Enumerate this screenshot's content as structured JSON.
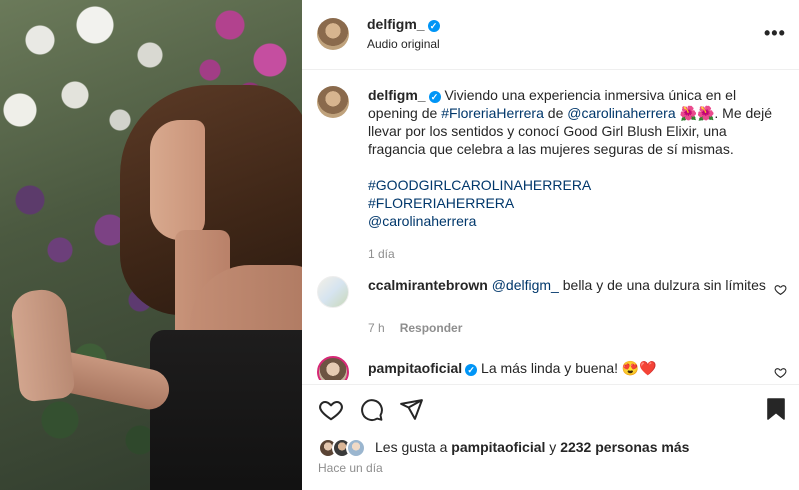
{
  "header": {
    "username": "delfigm_",
    "subtitle": "Audio original",
    "more_label": "•••"
  },
  "caption": {
    "username": "delfigm_",
    "text_1": "Viviendo una experiencia inmersiva única en el opening de ",
    "hashtag_floreria_inline": "#FloreriaHerrera",
    "text_2": " de ",
    "mention_inline": "@carolinaherrera",
    "emoji": "🌺🌺",
    "text_3": ". Me dejé llevar por los sentidos y conocí Good Girl Blush Elixir, una fragancia que celebra a las mujeres seguras de sí mismas.",
    "hashtag_1": "#GOODGIRLCAROLINAHERRERA",
    "hashtag_2": "#FLORERIAHERRERA",
    "mention_2": "@carolinaherrera",
    "time": "1 día"
  },
  "comments": [
    {
      "username": "ccalmirantebrown",
      "mention": "@delfigm_",
      "text": " bella y de una dulzura sin límites",
      "time": "7 h",
      "reply_label": "Responder"
    },
    {
      "username": "pampitaoficial",
      "text": "La más linda y buena! 😍❤️"
    }
  ],
  "likes": {
    "prefix": "Les gusta a ",
    "user": "pampitaoficial",
    "middle": " y ",
    "others": "2232 personas más"
  },
  "posted": "Hace un día",
  "icons": {
    "like": "heart-outline-icon",
    "comment": "comment-bubble-icon",
    "share": "paper-plane-icon",
    "save": "bookmark-filled-icon",
    "verified": "verified-badge-icon",
    "more": "more-dots-icon"
  },
  "colors": {
    "verified": "#0095f6",
    "link": "#00376b",
    "muted": "#8e8e8e",
    "text": "#262626"
  }
}
